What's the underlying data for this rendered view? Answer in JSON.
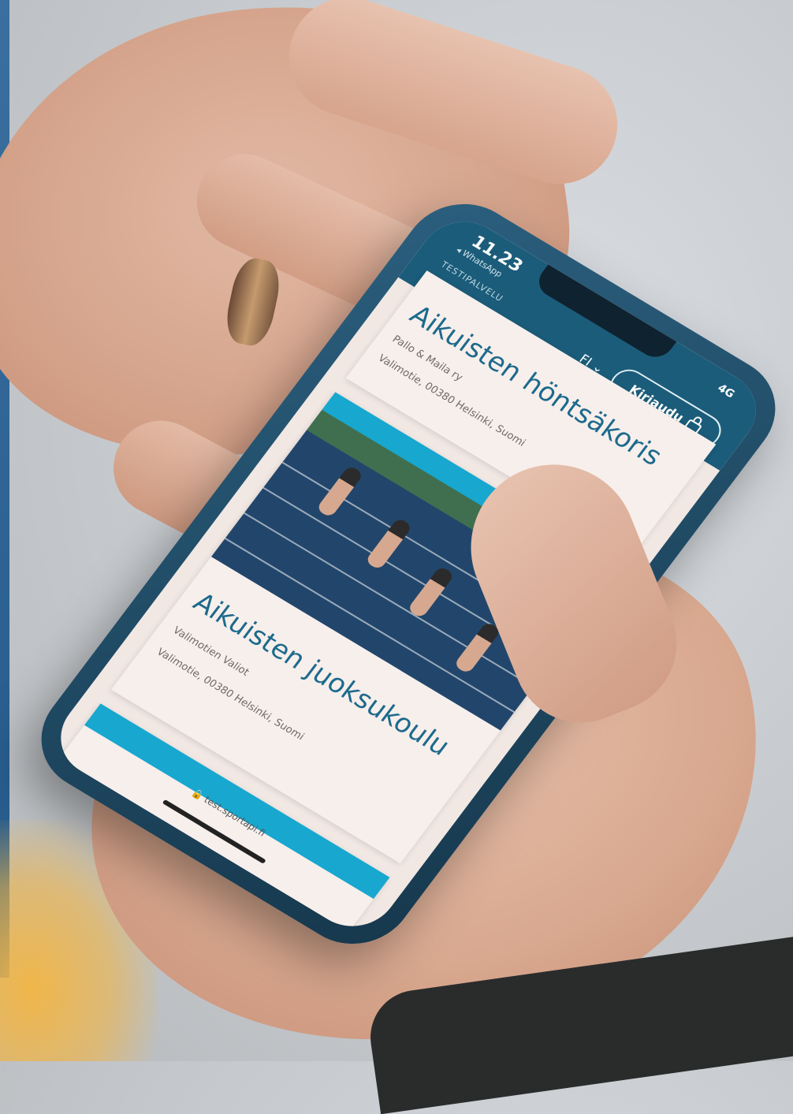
{
  "status_bar": {
    "time": "11.23",
    "back_app": "◂ WhatsApp",
    "signal": "4G"
  },
  "header": {
    "brand": "TESTIPALVELU",
    "language": "FI ⌄",
    "login_label": "Kirjaudu"
  },
  "cards": [
    {
      "title": "Aikuisten höntsäkoris",
      "organizer": "Pallo & Maila ry",
      "address": "Valimotie, 00380 Helsinki, Suomi"
    },
    {
      "title": "Aikuisten juoksukoulu",
      "organizer": "Valimotien Valiot",
      "address": "Valimotie, 00380 Helsinki, Suomi"
    }
  ],
  "browser": {
    "url": "🔒 test.sportapi.fi"
  }
}
